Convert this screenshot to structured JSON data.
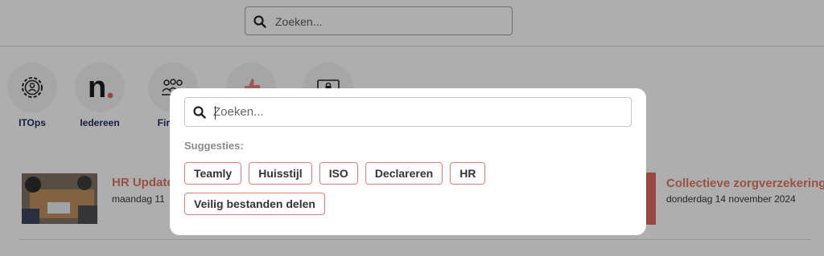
{
  "header": {
    "search_placeholder": "Zoeken..."
  },
  "apps": [
    {
      "label": "ITOps",
      "icon": "gear-person-icon"
    },
    {
      "label": "Iedereen",
      "icon": "n-logo-icon"
    },
    {
      "label": "Financ",
      "icon": "group-icon"
    },
    {
      "label": "",
      "icon": "thumbs-up-icon"
    },
    {
      "label": "",
      "icon": "lock-screen-icon"
    }
  ],
  "news": [
    {
      "title": "HR Update",
      "date": "maandag 11"
    },
    {
      "title": "Collectieve zorgverzekering",
      "date": "donderdag 14 november 2024"
    }
  ],
  "modal": {
    "search_placeholder": "Zoeken...",
    "suggestions_label": "Suggesties:",
    "suggestions": [
      "Teamly",
      "Huisstijl",
      "ISO",
      "Declareren",
      "HR",
      "Veilig bestanden delen"
    ]
  },
  "colors": {
    "accent": "#d6705f",
    "chip_border": "#d9827a",
    "app_label": "#1e2a55",
    "overlay": "rgba(0,0,0,0.28)"
  }
}
